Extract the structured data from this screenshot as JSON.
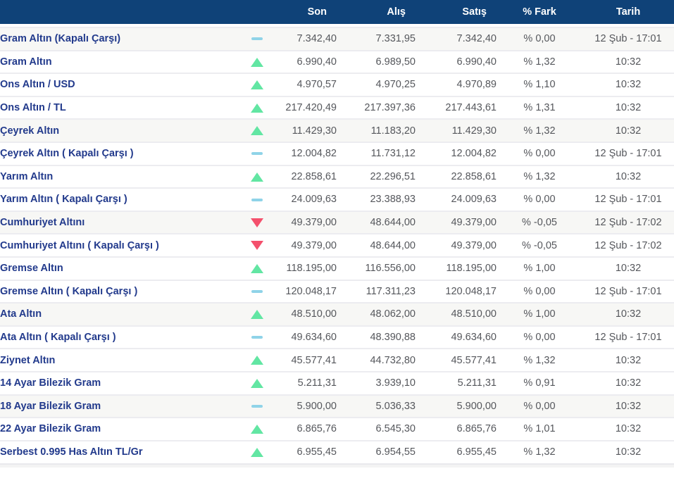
{
  "colors": {
    "header_bg": "#0f4278",
    "row_label": "#223a8c",
    "value_text": "#55575c",
    "trend_up": "#62e6a3",
    "trend_down": "#f4506c",
    "trend_flat": "#8fd3e8",
    "shaded_row_bg": "#f7f7f5",
    "row_line": "#ececf0"
  },
  "table": {
    "columns": {
      "name": "",
      "trend": "",
      "son": "Son",
      "alis": "Alış",
      "satis": "Satış",
      "fark": "% Fark",
      "tarih": "Tarih"
    },
    "rows": [
      {
        "name": "Gram Altın (Kapalı Çarşı)",
        "trend": "flat",
        "son": "7.342,40",
        "alis": "7.331,95",
        "satis": "7.342,40",
        "fark": "% 0,00",
        "tarih": "12 Şub - 17:01"
      },
      {
        "name": "Gram Altın",
        "trend": "up",
        "son": "6.990,40",
        "alis": "6.989,50",
        "satis": "6.990,40",
        "fark": "% 1,32",
        "tarih": "10:32"
      },
      {
        "name": "Ons Altın / USD",
        "trend": "up",
        "son": "4.970,57",
        "alis": "4.970,25",
        "satis": "4.970,89",
        "fark": "% 1,10",
        "tarih": "10:32"
      },
      {
        "name": "Ons Altın / TL",
        "trend": "up",
        "son": "217.420,49",
        "alis": "217.397,36",
        "satis": "217.443,61",
        "fark": "% 1,31",
        "tarih": "10:32"
      },
      {
        "name": "Çeyrek Altın",
        "trend": "up",
        "son": "11.429,30",
        "alis": "11.183,20",
        "satis": "11.429,30",
        "fark": "% 1,32",
        "tarih": "10:32"
      },
      {
        "name": "Çeyrek Altın ( Kapalı Çarşı )",
        "trend": "flat",
        "son": "12.004,82",
        "alis": "11.731,12",
        "satis": "12.004,82",
        "fark": "% 0,00",
        "tarih": "12 Şub - 17:01"
      },
      {
        "name": "Yarım Altın",
        "trend": "up",
        "son": "22.858,61",
        "alis": "22.296,51",
        "satis": "22.858,61",
        "fark": "% 1,32",
        "tarih": "10:32"
      },
      {
        "name": "Yarım Altın ( Kapalı Çarşı )",
        "trend": "flat",
        "son": "24.009,63",
        "alis": "23.388,93",
        "satis": "24.009,63",
        "fark": "% 0,00",
        "tarih": "12 Şub - 17:01"
      },
      {
        "name": "Cumhuriyet Altını",
        "trend": "down",
        "son": "49.379,00",
        "alis": "48.644,00",
        "satis": "49.379,00",
        "fark": "% -0,05",
        "tarih": "12 Şub - 17:02"
      },
      {
        "name": "Cumhuriyet Altını ( Kapalı Çarşı )",
        "trend": "down",
        "son": "49.379,00",
        "alis": "48.644,00",
        "satis": "49.379,00",
        "fark": "% -0,05",
        "tarih": "12 Şub - 17:02"
      },
      {
        "name": "Gremse Altın",
        "trend": "up",
        "son": "118.195,00",
        "alis": "116.556,00",
        "satis": "118.195,00",
        "fark": "% 1,00",
        "tarih": "10:32"
      },
      {
        "name": "Gremse Altın ( Kapalı Çarşı )",
        "trend": "flat",
        "son": "120.048,17",
        "alis": "117.311,23",
        "satis": "120.048,17",
        "fark": "% 0,00",
        "tarih": "12 Şub - 17:01"
      },
      {
        "name": "Ata Altın",
        "trend": "up",
        "son": "48.510,00",
        "alis": "48.062,00",
        "satis": "48.510,00",
        "fark": "% 1,00",
        "tarih": "10:32"
      },
      {
        "name": "Ata Altın ( Kapalı Çarşı )",
        "trend": "flat",
        "son": "49.634,60",
        "alis": "48.390,88",
        "satis": "49.634,60",
        "fark": "% 0,00",
        "tarih": "12 Şub - 17:01"
      },
      {
        "name": "Ziynet Altın",
        "trend": "up",
        "son": "45.577,41",
        "alis": "44.732,80",
        "satis": "45.577,41",
        "fark": "% 1,32",
        "tarih": "10:32"
      },
      {
        "name": "14 Ayar Bilezik Gram",
        "trend": "up",
        "son": "5.211,31",
        "alis": "3.939,10",
        "satis": "5.211,31",
        "fark": "% 0,91",
        "tarih": "10:32"
      },
      {
        "name": "18 Ayar Bilezik Gram",
        "trend": "flat",
        "son": "5.900,00",
        "alis": "5.036,33",
        "satis": "5.900,00",
        "fark": "% 0,00",
        "tarih": "10:32"
      },
      {
        "name": "22 Ayar Bilezik Gram",
        "trend": "up",
        "son": "6.865,76",
        "alis": "6.545,30",
        "satis": "6.865,76",
        "fark": "% 1,01",
        "tarih": "10:32"
      },
      {
        "name": "Serbest 0.995 Has Altın TL/Gr",
        "trend": "up",
        "son": "6.955,45",
        "alis": "6.954,55",
        "satis": "6.955,45",
        "fark": "% 1,32",
        "tarih": "10:32"
      }
    ],
    "shaded_row_interval": 4
  }
}
